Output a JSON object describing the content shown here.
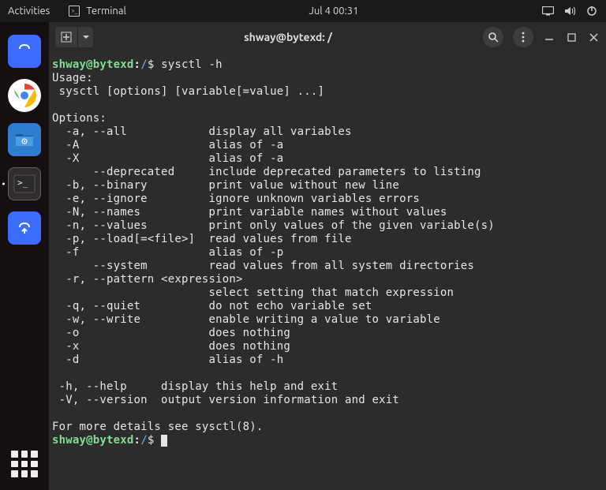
{
  "topbar": {
    "activities": "Activities",
    "app_name": "Terminal",
    "datetime": "Jul 4  00:31"
  },
  "dock": {
    "items": [
      {
        "name": "shopping-bag",
        "bg": "#3b6bff"
      },
      {
        "name": "chrome",
        "bg": "#ffffff"
      },
      {
        "name": "files",
        "bg": "#2f7dd1"
      },
      {
        "name": "terminal",
        "bg": "#2b2b2b",
        "active": true
      },
      {
        "name": "shopping-upload",
        "bg": "#3b6bff"
      }
    ]
  },
  "terminal": {
    "title": "shway@bytexd: /",
    "prompt_user": "shway@bytexd",
    "prompt_path": "/",
    "command": "sysctl -h",
    "output": "\nUsage:\n sysctl [options] [variable[=value] ...]\n\nOptions:\n  -a, --all            display all variables\n  -A                   alias of -a\n  -X                   alias of -a\n      --deprecated     include deprecated parameters to listing\n  -b, --binary         print value without new line\n  -e, --ignore         ignore unknown variables errors\n  -N, --names          print variable names without values\n  -n, --values         print only values of the given variable(s)\n  -p, --load[=<file>]  read values from file\n  -f                   alias of -p\n      --system         read values from all system directories\n  -r, --pattern <expression>\n                       select setting that match expression\n  -q, --quiet          do not echo variable set\n  -w, --write          enable writing a value to variable\n  -o                   does nothing\n  -x                   does nothing\n  -d                   alias of -h\n\n -h, --help     display this help and exit\n -V, --version  output version information and exit\n\nFor more details see sysctl(8)."
  }
}
